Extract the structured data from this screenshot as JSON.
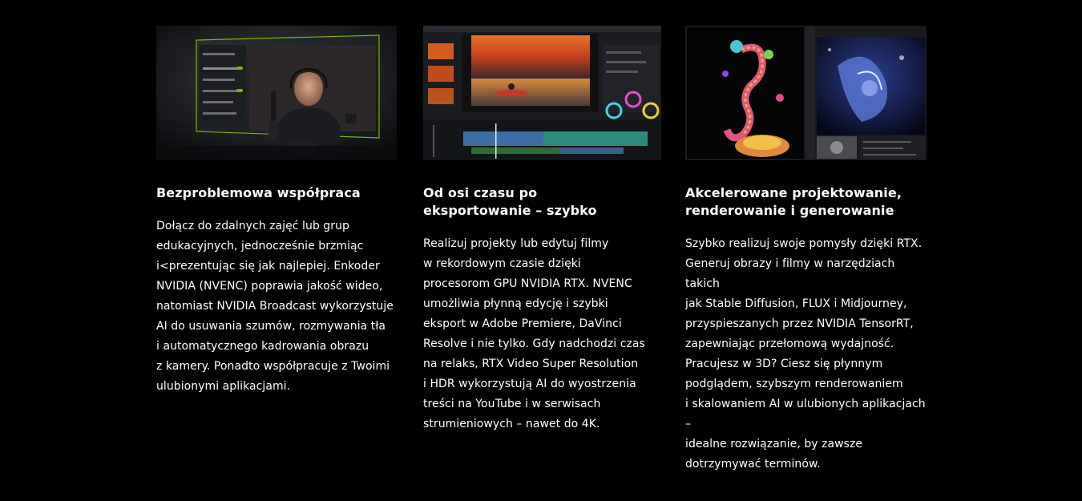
{
  "cards": [
    {
      "title": "Bezproblemowa współpraca",
      "text": "Dołącz do zdalnych zajęć lub grup\nedukacyjnych, jednocześnie brzmiąc\ni<prezentując się jak najlepiej. Enkoder\nNVIDIA (NVENC) poprawia jakość wideo,\nnatomiast NVIDIA Broadcast wykorzystuje\nAI do usuwania szumów, rozmywania tła\ni automatycznego kadrowania obrazu\nz kamery. Ponadto współpracuje z Twoimi\nulubionymi aplikacjami.",
      "image": "broadcast-app-video-call-screen"
    },
    {
      "title": "Od osi czasu po\neksportowanie – szybko",
      "text": "Realizuj projekty lub edytuj filmy\nw rekordowym czasie dzięki\nprocesorom GPU NVIDIA RTX. NVENC\numożliwia płynną edycję i szybki\neksport w Adobe Premiere, DaVinci\nResolve i nie tylko. Gdy nadchodzi czas\nna relaks, RTX Video Super Resolution\ni HDR wykorzystują AI do wyostrzenia\ntreści na YouTube i w serwisach\nstrumieniowych – nawet do 4K.",
      "image": "video-editor-timeline-screen"
    },
    {
      "title": "Akcelerowane projektowanie,\nrenderowanie i generowanie",
      "text": "Szybko realizuj swoje pomysły dzięki RTX.\nGeneruj obrazy i filmy w narzędziach takich\njak Stable Diffusion, FLUX i Midjourney,\nprzyspieszanych przez NVIDIA TensorRT,\nzapewniając przełomową wydajność.\nPracujesz w 3D? Ciesz się płynnym\npodglądem, szybszym renderowaniem\ni skalowaniem AI w ulubionych aplikacjach –\nidealne rozwiązanie, by zawsze\ndotrzymywać terminów.",
      "image": "3d-render-seahorse-screen"
    }
  ]
}
